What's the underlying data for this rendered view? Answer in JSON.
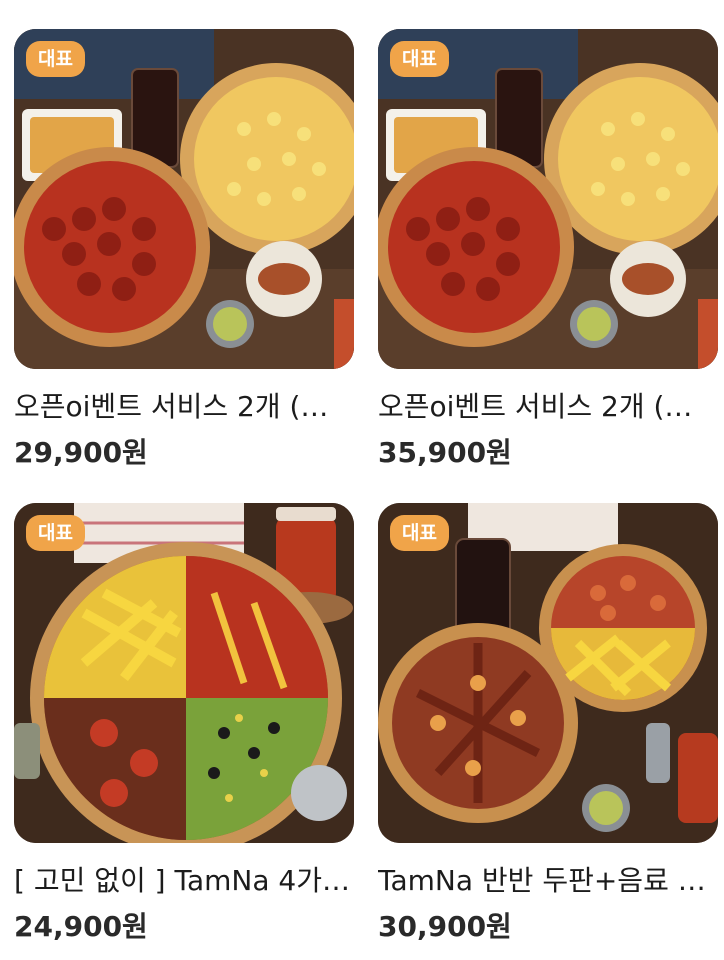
{
  "accent_color": "#f0a449",
  "products": [
    {
      "badge": "대표",
      "title": "오픈oi벤트 서비스 2개 (…",
      "price": "29,900원",
      "image": "pizza-set-pepperoni-hawaiian-photo"
    },
    {
      "badge": "대표",
      "title": "오픈oi벤트 서비스 2개 (…",
      "price": "35,900원",
      "image": "pizza-set-pepperoni-hawaiian-photo"
    },
    {
      "badge": "대표",
      "title": "[ 고민 없이 ] TamNa 4가…",
      "price": "24,900원",
      "image": "four-flavor-pizza-photo"
    },
    {
      "badge": "대표",
      "title": "TamNa 반반 두판+음료 …",
      "price": "30,900원",
      "image": "half-half-two-pizzas-drink-photo"
    }
  ]
}
